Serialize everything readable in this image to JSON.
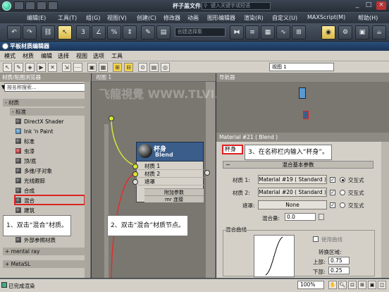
{
  "app": {
    "title": "杯子盖文件.max",
    "search_placeholder": "键入关键字或短语",
    "menus": [
      "编辑(E)",
      "工具(T)",
      "组(G)",
      "视图(V)",
      "创建(C)",
      "修改器",
      "动画",
      "图形编辑器",
      "渲染(R)",
      "自定义(U)",
      "MAXScript(M)",
      "帮助(H)"
    ]
  },
  "toolbar": {
    "selection_set_placeholder": "创建选择集",
    "scale_label": "3"
  },
  "slate": {
    "title": "平板材质编辑器",
    "menus": [
      "模式",
      "材质",
      "编辑",
      "选择",
      "视图",
      "选项",
      "工具"
    ],
    "view_select": "视图 1"
  },
  "browser": {
    "header": "材质/贴图浏览器",
    "search_placeholder": "按名称搜索...",
    "category_materials": "- 材质",
    "category_standard": "- 标准",
    "items": [
      {
        "label": "DirectX Shader",
        "icon": "material-swatch-icon"
      },
      {
        "label": "Ink 'n Paint",
        "icon": "ink-paint-icon"
      },
      {
        "label": "标准",
        "icon": "material-swatch-icon"
      },
      {
        "label": "虫漆",
        "icon": "shellac-icon"
      },
      {
        "label": "顶/底",
        "icon": "material-swatch-icon"
      },
      {
        "label": "多维/子对象",
        "icon": "material-swatch-icon"
      },
      {
        "label": "光线跟踪",
        "icon": "material-swatch-icon"
      },
      {
        "label": "合成",
        "icon": "material-swatch-icon"
      },
      {
        "label": "混合",
        "icon": "material-swatch-icon"
      },
      {
        "label": "建筑",
        "icon": "material-swatch-icon"
      }
    ],
    "extra_items": [
      "外部参照材质"
    ],
    "category_mentalray": "+ mental ray",
    "category_metasl": "+ MetaSL"
  },
  "canvas": {
    "header": "视图 1"
  },
  "node": {
    "title": "杯身",
    "type": "Blend",
    "ports": [
      "材质 1",
      "材质 2",
      "遮罩"
    ],
    "sub1": "附加参数",
    "sub2": "mr 连接"
  },
  "navigator": {
    "header": "导航器"
  },
  "params": {
    "header": "Material #21  ( Blend )",
    "name_value": "杯身",
    "rollout_title": "混合基本参数",
    "mat1_label": "材质 1:",
    "mat1_value": "Material #19 ( Standard )",
    "mat2_label": "材质 2:",
    "mat2_value": "Material #20 ( Standard )",
    "mask_label": "遮罩:",
    "mask_value": "None",
    "interactive_label": "交互式",
    "mix_amount_label": "混合量:",
    "mix_amount_value": "0.0",
    "mix_curve_label": "混合曲线",
    "use_curve_label": "使用曲线",
    "transition_label": "转换区域:",
    "upper_label": "上部:",
    "upper_value": "0.75",
    "lower_label": "下部:",
    "lower_value": "0.25"
  },
  "callouts": {
    "step1": "1、双击“混合”材质。",
    "step2": "2、双击“混合”材质节点。",
    "step3": "3、在名称栏内输入“杯身”。"
  },
  "status": {
    "text": "已完成渲染",
    "zoom": "100%"
  },
  "watermark": "飞龍視覺 WWW.TLVI.NET",
  "colors": {
    "highlight_red": "#dd2222",
    "wire_red": "#e0302a",
    "wire_green": "#d8e636"
  }
}
